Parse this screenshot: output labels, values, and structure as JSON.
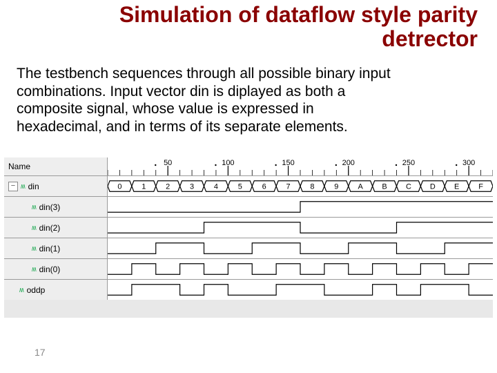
{
  "title": "Simulation of dataflow style parity detrector",
  "body": "The testbench sequences through all possible binary input combinations. Input vector  din  is diplayed as both a composite signal, whose value is expressed in hexadecimal, and in terms of its separate elements.",
  "page_number": "17",
  "viewer": {
    "name_header": "Name",
    "ruler_ticks": [
      {
        "t": 50,
        "label": "50"
      },
      {
        "t": 100,
        "label": "100"
      },
      {
        "t": 150,
        "label": "150"
      },
      {
        "t": 200,
        "label": "200"
      },
      {
        "t": 250,
        "label": "250"
      },
      {
        "t": 300,
        "label": "300"
      }
    ],
    "t_end": 320,
    "dt": 20,
    "bus": {
      "name": "din",
      "values": [
        "0",
        "1",
        "2",
        "3",
        "4",
        "5",
        "6",
        "7",
        "8",
        "9",
        "A",
        "B",
        "C",
        "D",
        "E",
        "F"
      ]
    },
    "signals": [
      {
        "name": "din(3)",
        "bit": 3
      },
      {
        "name": "din(2)",
        "bit": 2
      },
      {
        "name": "din(1)",
        "bit": 1
      },
      {
        "name": "din(0)",
        "bit": 0
      }
    ],
    "parity": {
      "name": "oddp"
    }
  }
}
